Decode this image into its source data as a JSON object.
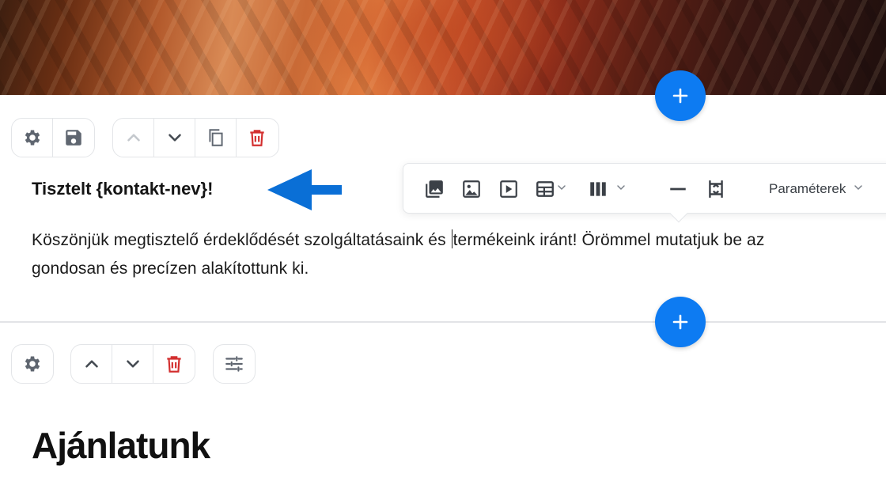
{
  "colors": {
    "accent": "#0d7bf2",
    "danger": "#d32f2f",
    "icon": "#5f6670",
    "icon_disabled": "#c4c8cd",
    "divider": "#e2e4e7"
  },
  "block1": {
    "toolbar_left": [
      {
        "name": "settings-gear-icon",
        "label": "Settings"
      },
      {
        "name": "save-disk-icon",
        "label": "Save"
      }
    ],
    "toolbar_right": [
      {
        "name": "move-up-icon",
        "label": "Move up",
        "disabled": true
      },
      {
        "name": "move-down-icon",
        "label": "Move down"
      },
      {
        "name": "duplicate-icon",
        "label": "Duplicate"
      },
      {
        "name": "delete-trash-icon",
        "label": "Delete"
      }
    ],
    "heading": "Tisztelt {kontakt-nev}!",
    "paragraph_line1_before_caret": "Köszönjük megtisztelő érdeklődését szolgáltatásaink és ",
    "paragraph_line1_after_caret": "termékeink iránt! Örömmel mutatjuk be az",
    "paragraph_line2": "gondosan és precízen alakítottunk ki."
  },
  "format_toolbar": {
    "items": [
      {
        "name": "gallery-icon"
      },
      {
        "name": "image-icon"
      },
      {
        "name": "video-icon"
      },
      {
        "name": "table-icon",
        "has_dropdown": true
      },
      {
        "name": "columns-icon",
        "has_dropdown": true
      },
      {
        "name": "horizontal-line-icon"
      },
      {
        "name": "spacer-icon"
      }
    ],
    "parameters_label": "Paraméterek"
  },
  "block2": {
    "toolbar": [
      {
        "name": "settings-gear-icon"
      },
      {
        "name": "move-up-icon"
      },
      {
        "name": "move-down-icon"
      },
      {
        "name": "delete-trash-icon"
      },
      {
        "name": "sliders-icon"
      }
    ],
    "heading": "Ajánlatunk"
  },
  "annotation_arrow": {
    "name": "arrow-left-icon",
    "color": "#0a6fd6"
  }
}
